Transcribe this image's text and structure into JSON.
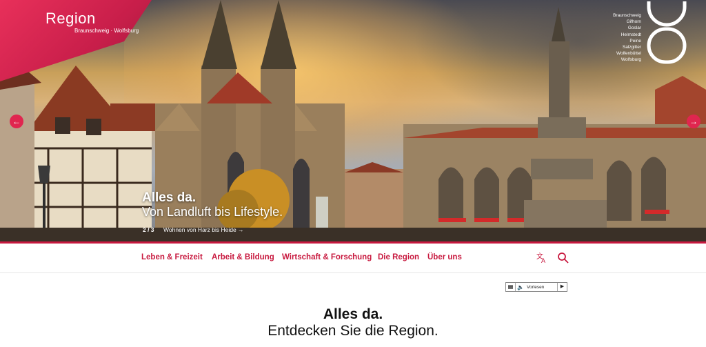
{
  "brand": {
    "title": "Region",
    "subtitle": "Braunschweig · Wolfsburg",
    "color": "#c8193f"
  },
  "cities": [
    "Braunschweig",
    "Gifhorn",
    "Goslar",
    "Helmstedt",
    "Peine",
    "Salzgitter",
    "Wolfenbüttel",
    "Wolfsburg"
  ],
  "hero": {
    "title": "Alles da.",
    "subtitle": "Von Landluft bis Lifestyle.",
    "counter": "2 / 3",
    "link": "Wohnen von Harz bis Heide →",
    "prev_icon": "arrow-left-icon",
    "next_icon": "arrow-right-icon"
  },
  "nav": {
    "items": [
      {
        "label": "Leben & Freizeit"
      },
      {
        "label": "Arbeit & Bildung"
      },
      {
        "label": "Wirtschaft & Forschung"
      },
      {
        "label": "Die Region"
      },
      {
        "label": "Über uns"
      }
    ],
    "translate_icon": "translate-icon",
    "search_icon": "search-icon"
  },
  "readspeaker": {
    "label": "Vorlesen"
  },
  "main": {
    "heading": "Alles da.",
    "subheading": "Entdecken Sie die Region."
  }
}
